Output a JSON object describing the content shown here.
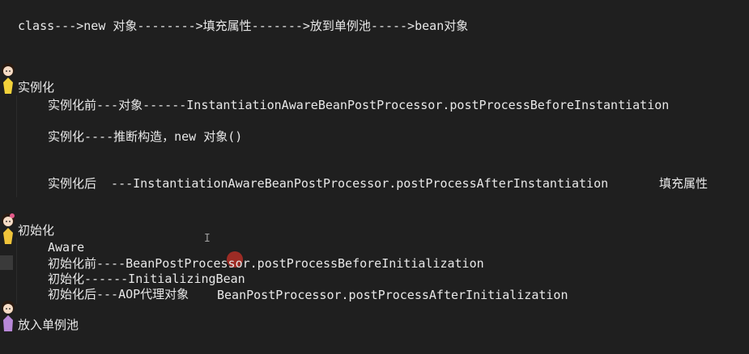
{
  "lines": {
    "flow": "class--->new 对象-------->填充属性------->放到单例池----->bean对象",
    "instantiation_heading": "实例化",
    "before_instantiation": "实例化前---对象------InstantiationAwareBeanPostProcessor.postProcessBeforeInstantiation",
    "instantiation": "实例化----推断构造，new 对象()",
    "after_instantiation": "实例化后  ---InstantiationAwareBeanPostProcessor.postProcessAfterInstantiation",
    "fill_properties": "填充属性",
    "initialization_heading": "初始化",
    "aware": "Aware",
    "before_initialization": "初始化前----BeanPostProcessor.postProcessBeforeInitialization",
    "initializing_bean": "初始化------InitializingBean",
    "after_initialization_prefix": "初始化后---AOP代理对象",
    "after_initialization_method": "BeanPostProcessor.postProcessAfterInitialization",
    "put_singleton_pool": "放入单例池"
  },
  "icons": {
    "avatar": "cartoon-girl-avatar-icon",
    "cursor": "text-cursor-icon",
    "pointer": "mouse-pointer-highlight-icon"
  },
  "colors": {
    "background": "#1f1f1f",
    "text": "#e8e8e8",
    "pointer_highlight": "#c83228"
  }
}
